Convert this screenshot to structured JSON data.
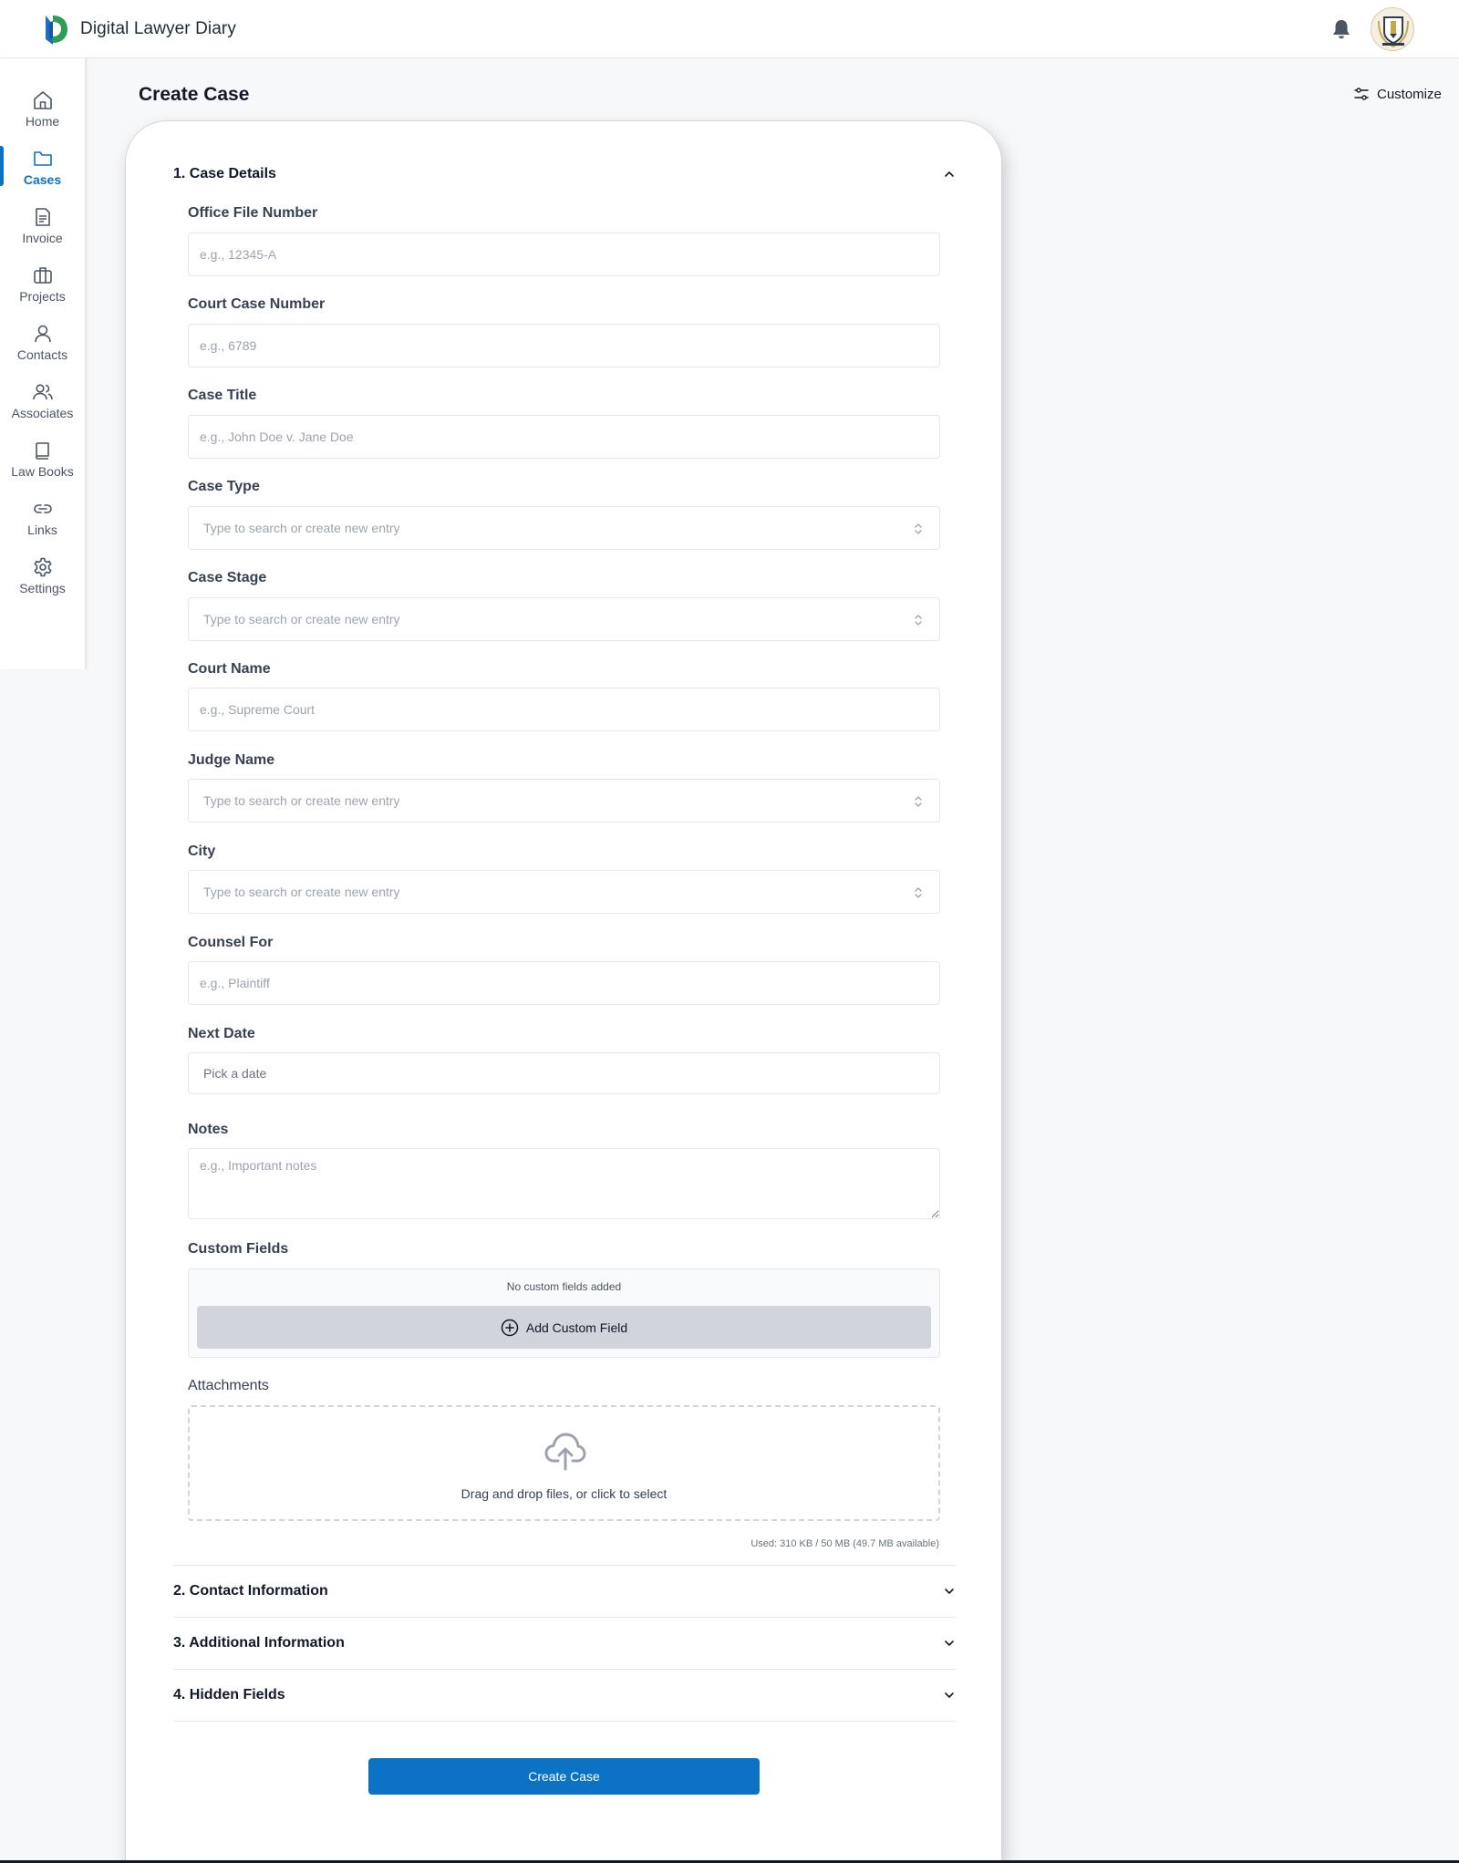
{
  "app": {
    "name": "Digital Lawyer Diary"
  },
  "sidebar": {
    "items": [
      {
        "label": "Home",
        "icon": "home-icon"
      },
      {
        "label": "Cases",
        "icon": "folder-icon",
        "active": true
      },
      {
        "label": "Invoice",
        "icon": "document-icon"
      },
      {
        "label": "Projects",
        "icon": "briefcase-icon"
      },
      {
        "label": "Contacts",
        "icon": "user-icon"
      },
      {
        "label": "Associates",
        "icon": "users-icon"
      },
      {
        "label": "Law Books",
        "icon": "book-icon"
      },
      {
        "label": "Links",
        "icon": "link-icon"
      },
      {
        "label": "Settings",
        "icon": "gear-icon"
      }
    ]
  },
  "page": {
    "title": "Create Case",
    "customize_label": "Customize"
  },
  "sections": {
    "case_details": "1. Case Details",
    "contact_information": "2. Contact Information",
    "additional_information": "3. Additional Information",
    "hidden_fields": "4. Hidden Fields"
  },
  "form": {
    "office_file_number": {
      "label": "Office File Number",
      "placeholder": "e.g., 12345-A",
      "value": ""
    },
    "court_case_number": {
      "label": "Court Case Number",
      "placeholder": "e.g., 6789",
      "value": ""
    },
    "case_title": {
      "label": "Case Title",
      "placeholder": "e.g., John Doe v. Jane Doe",
      "value": ""
    },
    "case_type": {
      "label": "Case Type",
      "placeholder": "Type to search or create new entry"
    },
    "case_stage": {
      "label": "Case Stage",
      "placeholder": "Type to search or create new entry"
    },
    "court_name": {
      "label": "Court Name",
      "placeholder": "e.g., Supreme Court",
      "value": ""
    },
    "judge_name": {
      "label": "Judge Name",
      "placeholder": "Type to search or create new entry"
    },
    "city": {
      "label": "City",
      "placeholder": "Type to search or create new entry"
    },
    "counsel_for": {
      "label": "Counsel For",
      "placeholder": "e.g., Plaintiff",
      "value": ""
    },
    "next_date": {
      "label": "Next Date",
      "placeholder": "Pick a date"
    },
    "notes": {
      "label": "Notes",
      "placeholder": "e.g., Important notes",
      "value": ""
    },
    "custom_fields": {
      "label": "Custom Fields",
      "empty_text": "No custom fields added",
      "add_label": "Add Custom Field"
    },
    "attachments": {
      "label": "Attachments",
      "dropzone_text": "Drag and drop files, or click to select",
      "storage_text": "Used: 310 KB / 50 MB (49.7 MB available)"
    },
    "submit_label": "Create Case"
  },
  "colors": {
    "accent": "#0b72c4",
    "background": "#f7f8f9"
  }
}
